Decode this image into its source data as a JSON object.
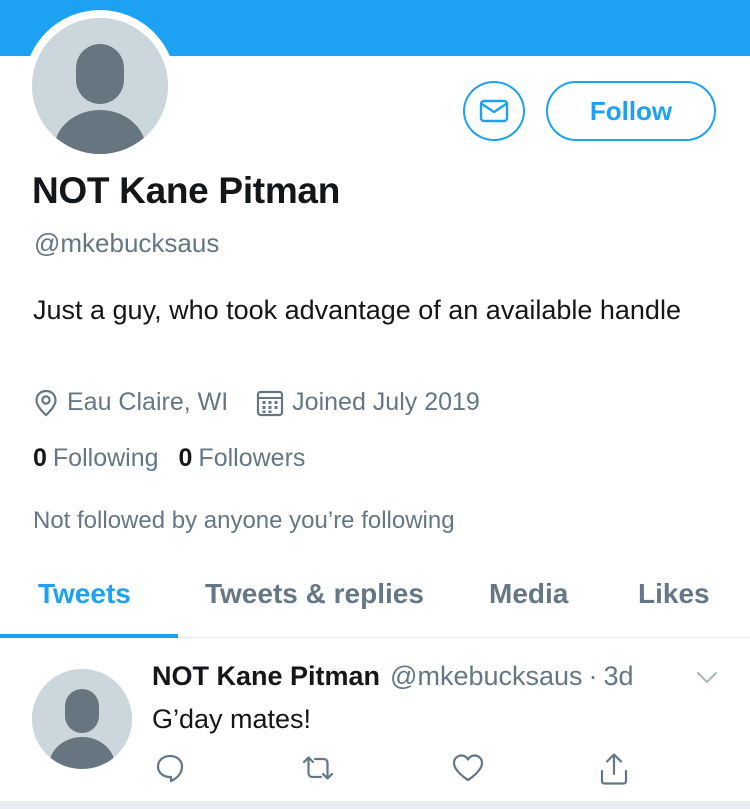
{
  "profile": {
    "name": "NOT Kane Pitman",
    "handle": "@mkebucksaus",
    "bio": "Just a guy, who took advantage of an available handle",
    "location": "Eau Claire, WI",
    "joined": "Joined July 2019",
    "following_count": "0",
    "following_label": "Following",
    "followers_count": "0",
    "followers_label": "Followers",
    "not_followed_text": "Not followed by anyone you’re following"
  },
  "buttons": {
    "follow_label": "Follow",
    "message_icon": "envelope-icon"
  },
  "tabs": [
    {
      "label": "Tweets",
      "active": true
    },
    {
      "label": "Tweets & replies",
      "active": false
    },
    {
      "label": "Media",
      "active": false
    },
    {
      "label": "Likes",
      "active": false
    }
  ],
  "tweet": {
    "name": "NOT Kane Pitman",
    "handle": "@mkebucksaus",
    "dot": "·",
    "time": "3d",
    "text": "G’day mates!",
    "actions": [
      "reply-icon",
      "retweet-icon",
      "like-icon",
      "share-icon"
    ]
  },
  "colors": {
    "accent": "#1da1f2",
    "secondary_text": "#657786",
    "avatar_bg": "#ccd6dd",
    "avatar_fg": "#66757f"
  }
}
